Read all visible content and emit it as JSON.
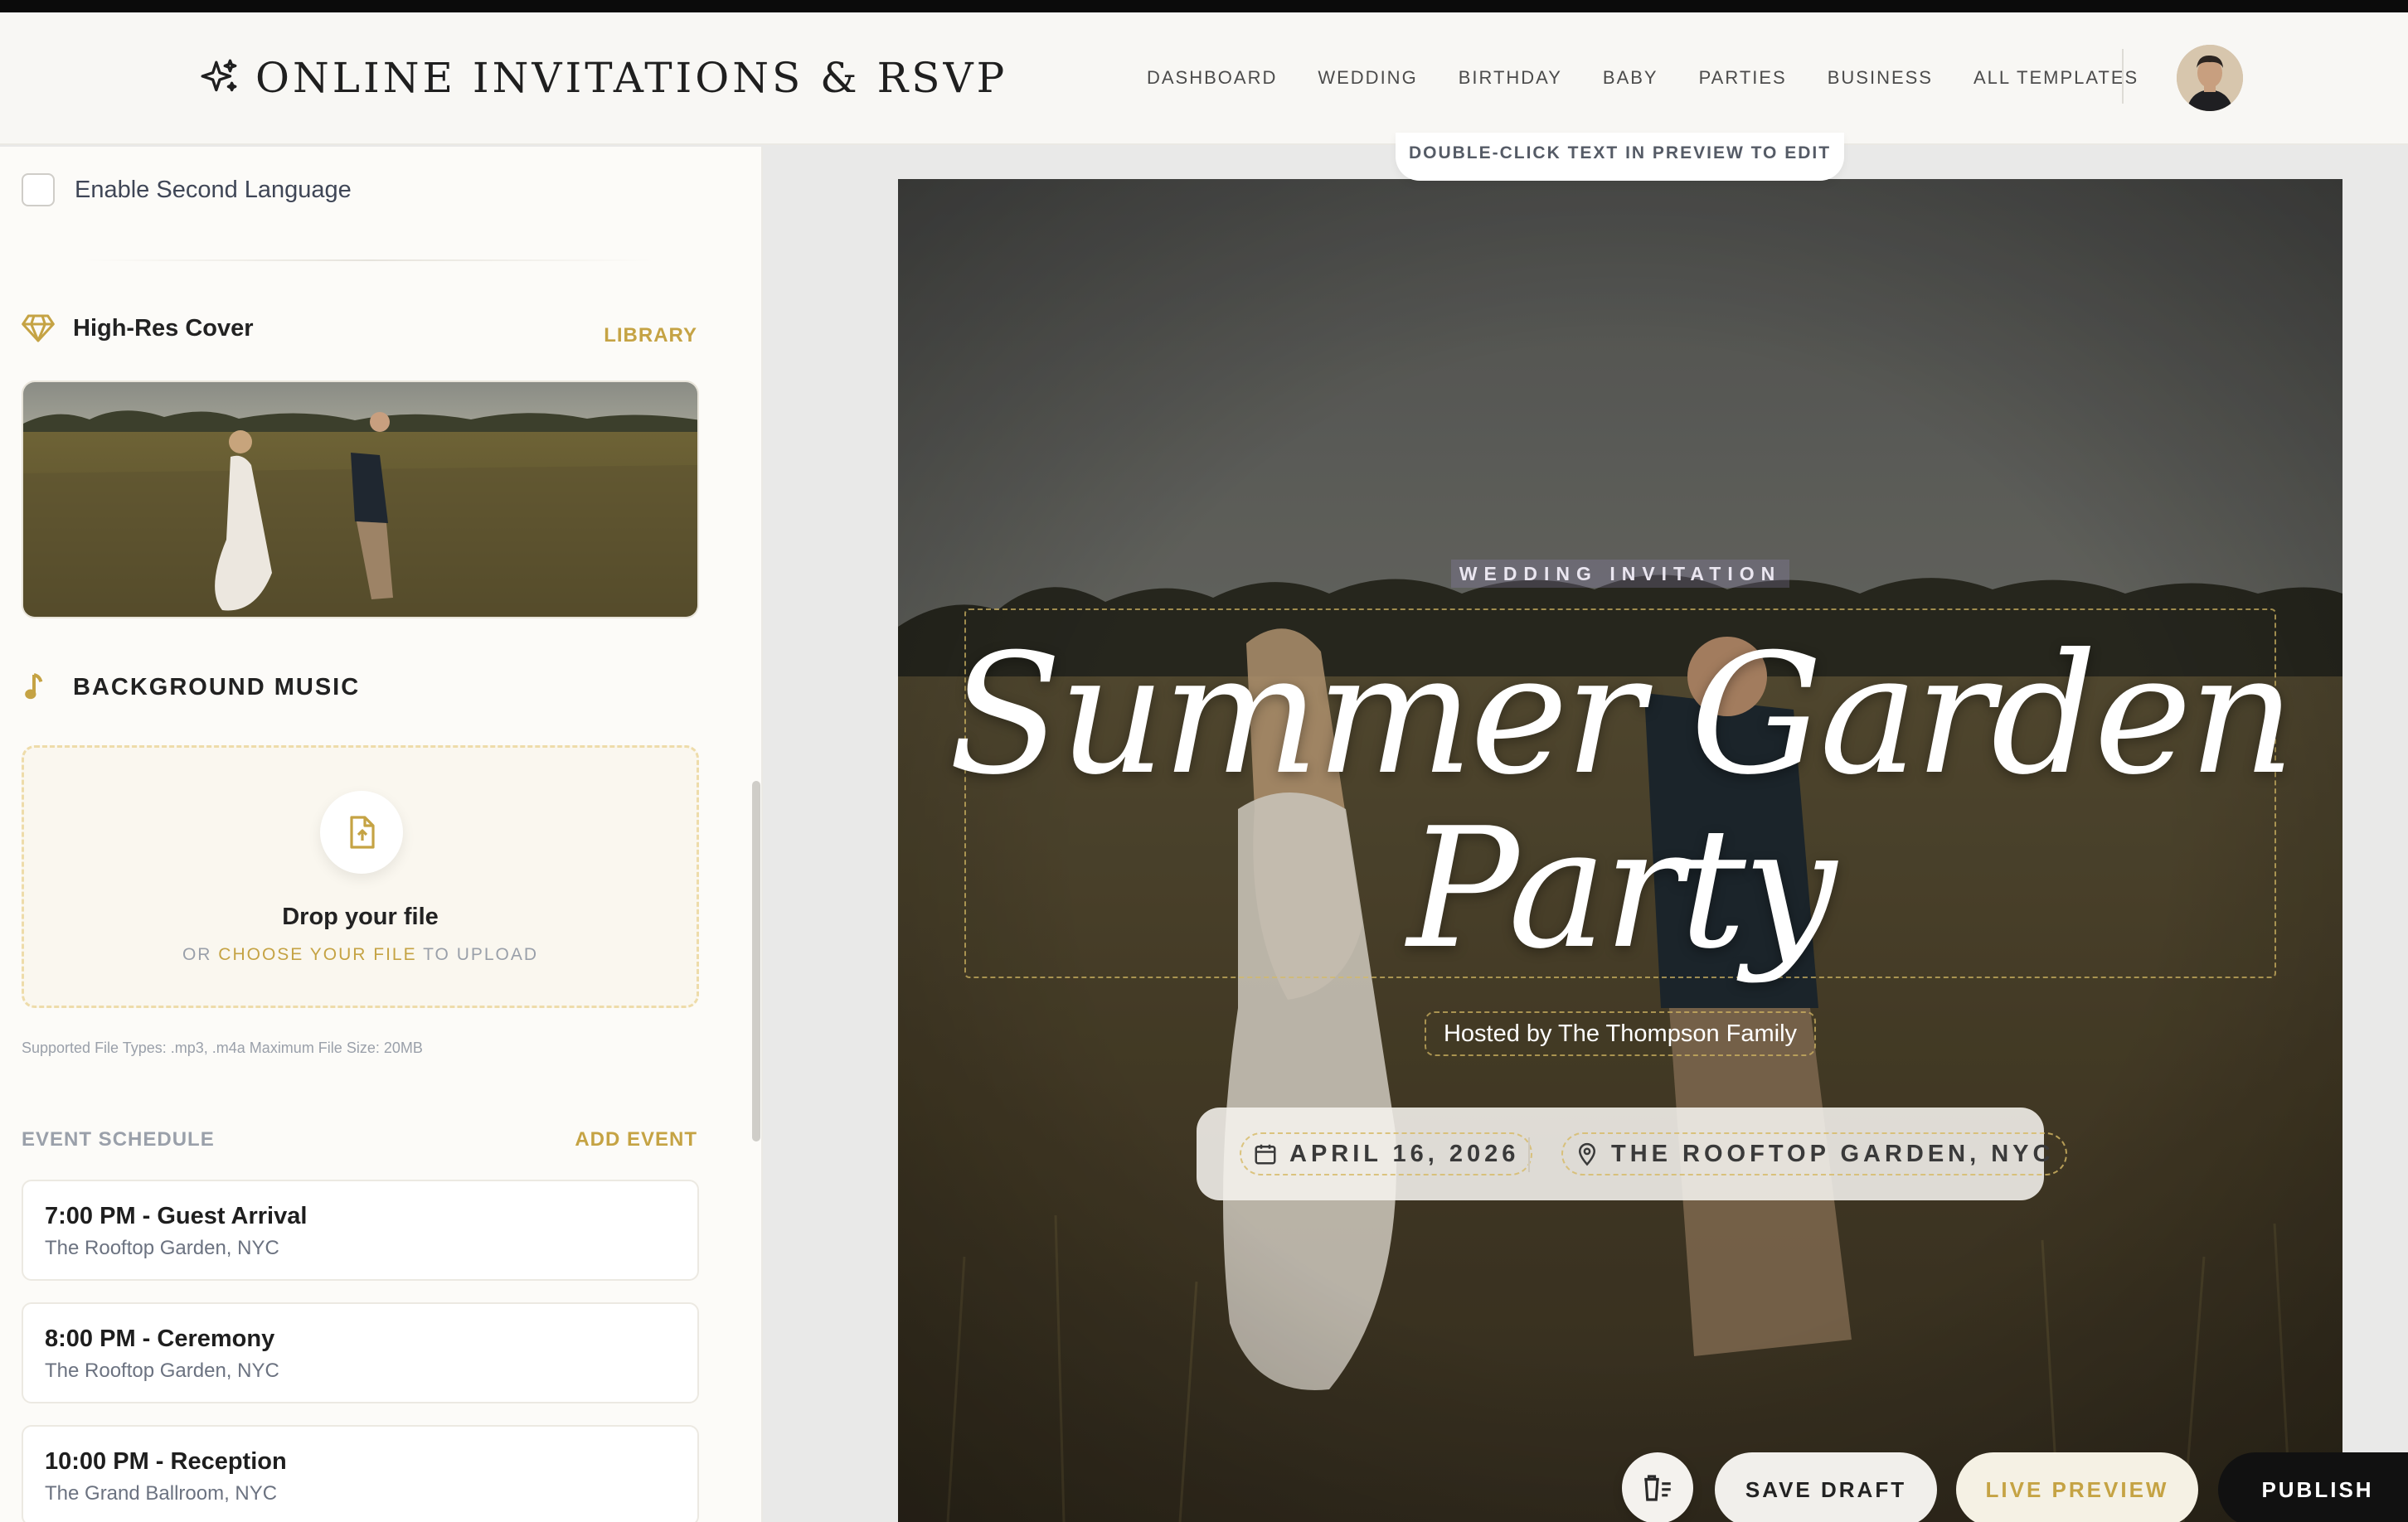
{
  "header": {
    "brand": "ONLINE INVITATIONS & RSVP",
    "nav": [
      "DASHBOARD",
      "WEDDING",
      "BIRTHDAY",
      "BABY",
      "PARTIES",
      "BUSINESS",
      "ALL TEMPLATES"
    ]
  },
  "sidebar": {
    "second_language_label": "Enable Second Language",
    "cover": {
      "title": "High-Res Cover",
      "link": "LIBRARY"
    },
    "music": {
      "title": "BACKGROUND MUSIC",
      "drop_title": "Drop your file",
      "drop_or": "OR",
      "drop_choose": "CHOOSE YOUR FILE",
      "drop_to": "TO UPLOAD",
      "filetypes": "Supported File Types: .mp3, .m4a Maximum File Size: 20MB"
    },
    "schedule": {
      "title": "EVENT SCHEDULE",
      "add": "ADD EVENT",
      "events": [
        {
          "title": "7:00 PM - Guest Arrival",
          "place": "The Rooftop Garden, NYC"
        },
        {
          "title": "8:00 PM - Ceremony",
          "place": "The Rooftop Garden, NYC"
        },
        {
          "title": "10:00 PM - Reception",
          "place": "The Grand Ballroom, NYC"
        }
      ]
    }
  },
  "preview": {
    "hint": "DOUBLE-CLICK TEXT IN PREVIEW TO EDIT",
    "label": "WEDDING INVITATION",
    "title_line1": "Summer Garden",
    "title_line2": "Party",
    "hosted": "Hosted by The Thompson Family",
    "date": "APRIL 16, 2026",
    "location": "THE ROOFTOP GARDEN, NYC"
  },
  "actions": {
    "save": "SAVE DRAFT",
    "live": "LIVE PREVIEW",
    "publish": "PUBLISH"
  },
  "colors": {
    "accent_gold": "#c5a344",
    "header_bg": "#f8f7f4",
    "publish_bg": "#111111"
  }
}
